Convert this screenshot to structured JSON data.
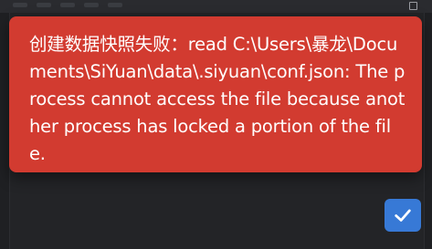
{
  "toast": {
    "message": "创建数据快照失败：read C:\\Users\\暴龙\\Documents\\SiYuan\\data\\.siyuan\\conf.json: The process cannot access the file because another process has locked a portion of the file.",
    "background_color": "#d23b30",
    "text_color": "#ffffff"
  },
  "confirm_button": {
    "icon": "checkmark-icon",
    "color": "#3779d6"
  },
  "window": {
    "corner_icon": "square-icon"
  }
}
